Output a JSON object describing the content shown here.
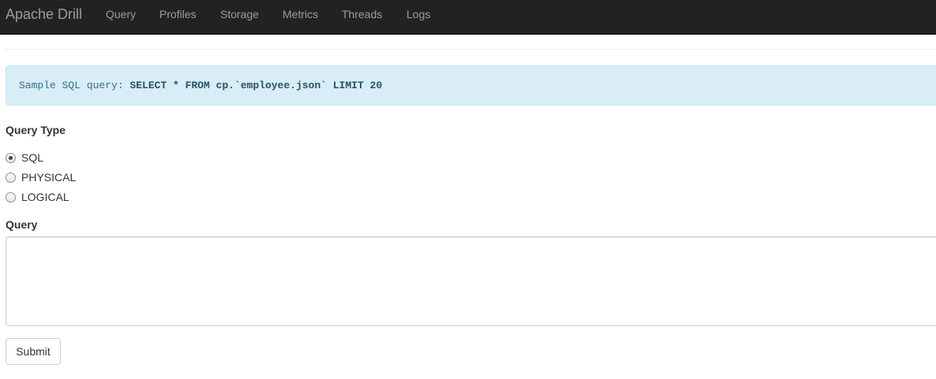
{
  "navbar": {
    "brand": "Apache Drill",
    "items": [
      {
        "label": "Query"
      },
      {
        "label": "Profiles"
      },
      {
        "label": "Storage"
      },
      {
        "label": "Metrics"
      },
      {
        "label": "Threads"
      },
      {
        "label": "Logs"
      }
    ]
  },
  "alert": {
    "prefix": "Sample SQL query: ",
    "sql": "SELECT * FROM cp.`employee.json` LIMIT 20"
  },
  "query_type": {
    "label": "Query Type",
    "options": [
      {
        "label": "SQL",
        "checked": true
      },
      {
        "label": "PHYSICAL",
        "checked": false
      },
      {
        "label": "LOGICAL",
        "checked": false
      }
    ]
  },
  "query": {
    "label": "Query",
    "value": ""
  },
  "submit": {
    "label": "Submit"
  },
  "colors": {
    "navbar_bg": "#222222",
    "nav_text": "#9d9d9d",
    "alert_bg": "#d9edf7",
    "alert_text": "#31708f"
  }
}
